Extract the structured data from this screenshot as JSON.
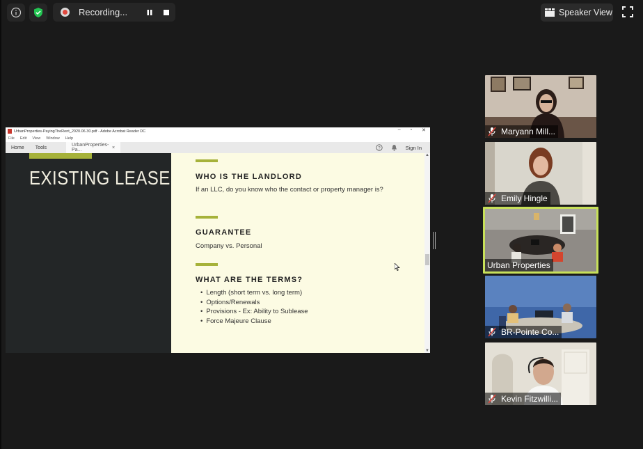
{
  "topbar": {
    "recording_label": "Recording...",
    "view_label": "Speaker View"
  },
  "shared_window": {
    "title": "UrbanProperties-PayingTheRent_2020.06.30.pdf - Adobe Acrobat Reader DC",
    "menu": [
      "File",
      "Edit",
      "View",
      "Window",
      "Help"
    ],
    "tabs": {
      "home": "Home",
      "tools": "Tools",
      "document": "UrbanProperties-Pa...",
      "close": "×"
    },
    "sign_in": "Sign In"
  },
  "slide": {
    "heading": "EXISTING LEASES",
    "sections": [
      {
        "title": "WHO IS THE LANDLORD",
        "body": "If an LLC, do you know who the contact or property manager is?"
      },
      {
        "title": "GUARANTEE",
        "body": "Company vs. Personal"
      },
      {
        "title": "WHAT ARE THE TERMS?",
        "body": ""
      }
    ],
    "bullets": [
      "Length (short term vs. long term)",
      "Options/Renewals",
      "Provisions - Ex: Ability to Sublease",
      "Force Majeure Clause"
    ],
    "accent_color": "#a6b23a"
  },
  "participants": [
    {
      "name": "Maryann Mill...",
      "muted": true
    },
    {
      "name": "Emily Hingle",
      "muted": true
    },
    {
      "name": "Urban Properties",
      "muted": false,
      "active": true
    },
    {
      "name": "BR-Pointe Co...",
      "muted": true
    },
    {
      "name": "Kevin Fitzwilli...",
      "muted": true
    }
  ]
}
